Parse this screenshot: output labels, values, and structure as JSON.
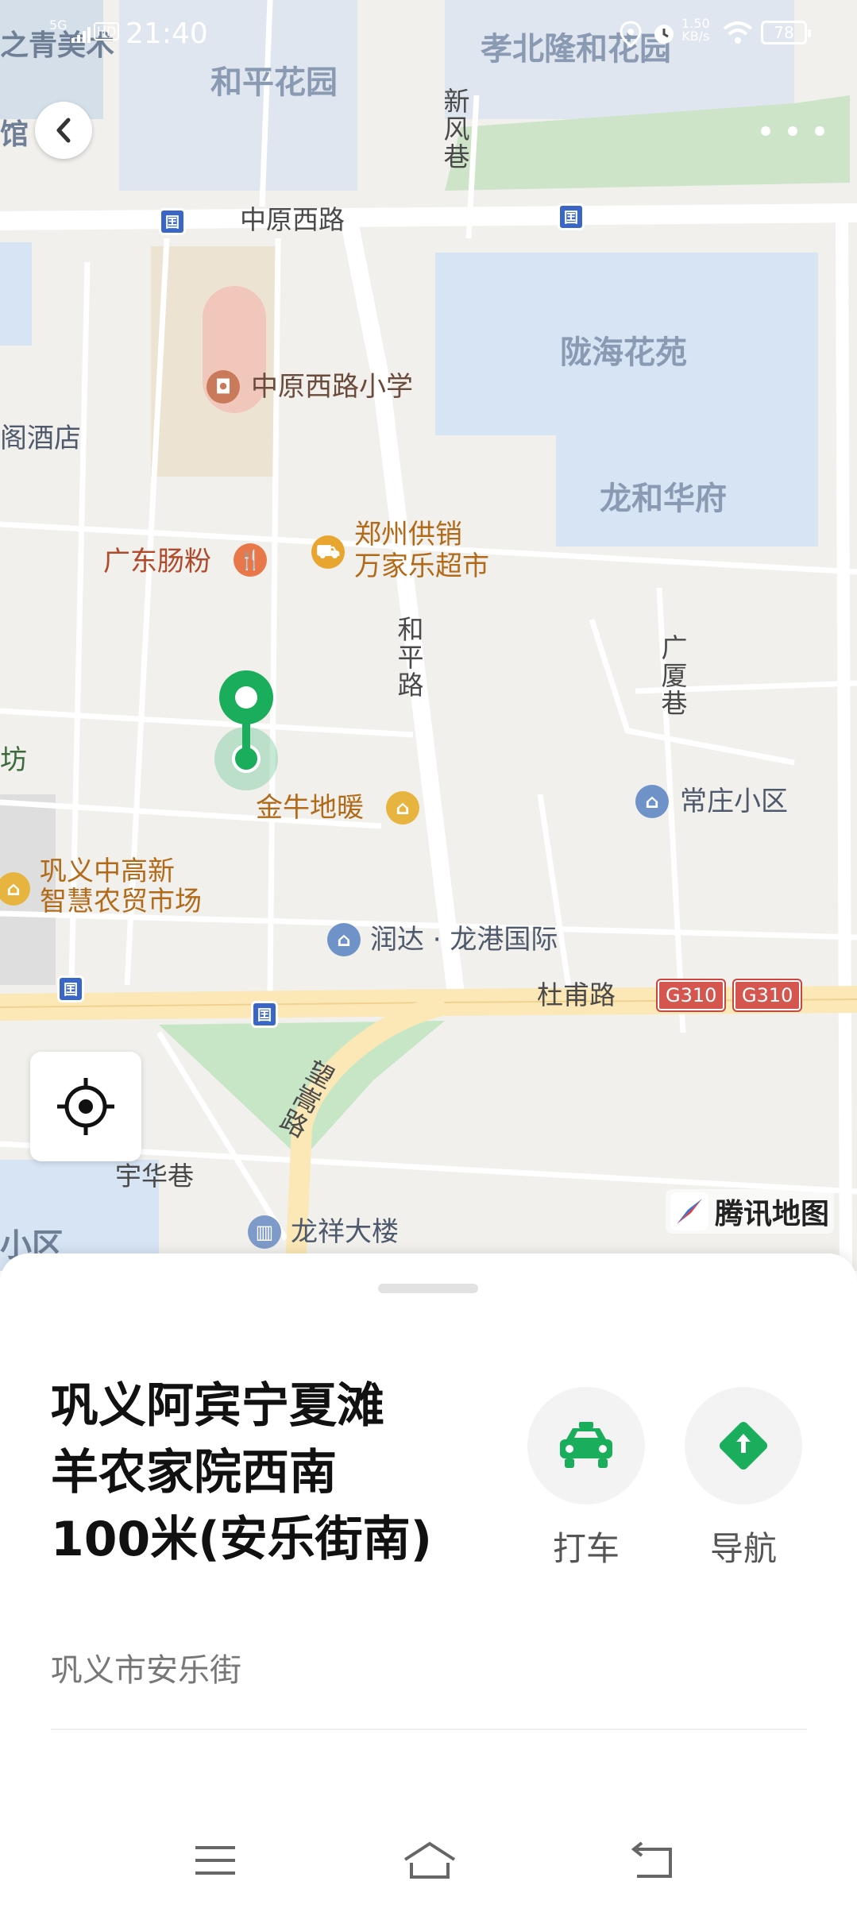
{
  "status_bar": {
    "network": "5G",
    "hd_label": "HD",
    "time": "21:40",
    "net_speed_value": "1.50",
    "net_speed_unit": "KB/s",
    "battery": "78"
  },
  "map": {
    "areas": {
      "qingmei": "之青美术",
      "guan": "馆",
      "heping_garden": "和平花园",
      "xiaobei": "孝北隆和花园",
      "longhai": "陇海花苑",
      "longhe": "龙和华府",
      "jiudian": "阁酒店",
      "fang": "坊",
      "xiaoqu": "小区"
    },
    "roads": {
      "zhongyuan_west": "中原西路",
      "xinfeng": "新风巷",
      "heping_rd": "和平路",
      "guangsha": "广厦巷",
      "dufu": "杜甫路",
      "wangsong": "望嵩路",
      "yuhua": "宇华巷",
      "g310_a": "G310",
      "g310_b": "G310",
      "bus_glyph": "囯"
    },
    "pois": {
      "school": "中原西路小学",
      "guangdong": "广东肠粉",
      "supermarket_line1": "郑州供销",
      "supermarket_line2": "万家乐超市",
      "jinniu": "金牛地暖",
      "changzhuang": "常庄小区",
      "gongyi_market_line1": "巩义中高新",
      "gongyi_market_line2": "智慧农贸市场",
      "runda": "润达 · 龙港国际",
      "longxiang": "龙祥大楼"
    },
    "brand": "腾讯地图",
    "colors": {
      "water_block": "#d6e4f4",
      "park": "#c7e6c5",
      "main_road": "#fbe8b6",
      "pin_green": "#1aad5b"
    }
  },
  "sheet": {
    "title_lines": [
      "巩义阿宾宁夏滩",
      "羊农家院西南",
      "100米(安乐街南)"
    ],
    "taxi_label": "打车",
    "navigate_label": "导航",
    "address": "巩义市安乐街"
  }
}
